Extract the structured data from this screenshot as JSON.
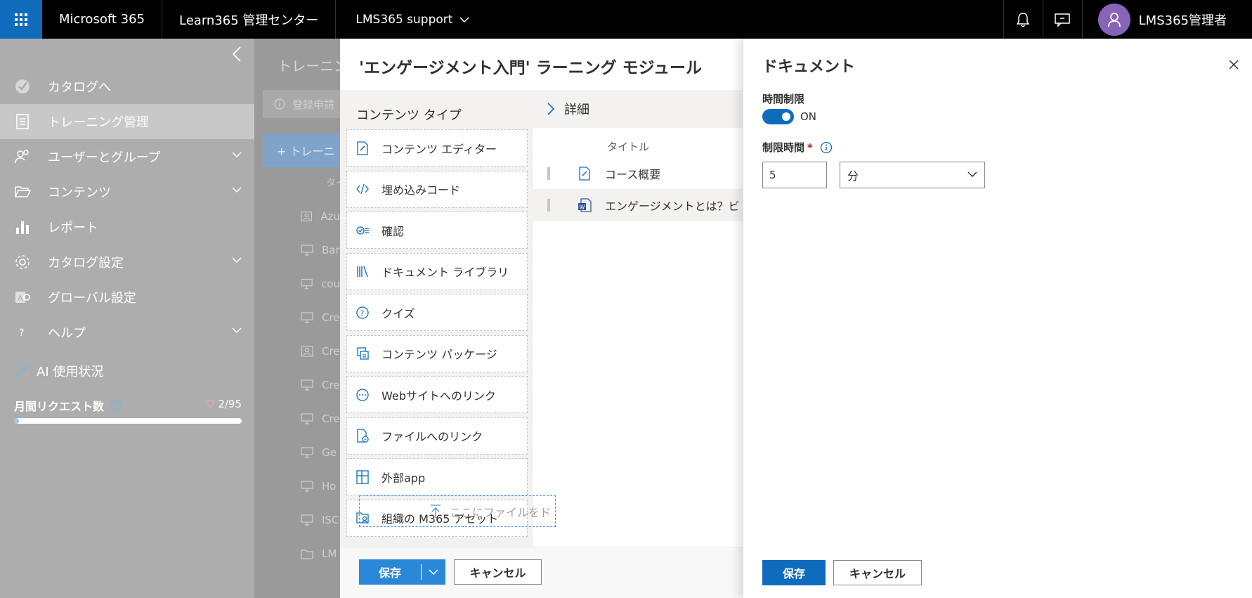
{
  "topbar": {
    "brand": "Microsoft 365",
    "app_title": "Learn365 管理センター",
    "tenant": "LMS365 support",
    "user_name": "LMS365管理者"
  },
  "sidebar": {
    "items": [
      {
        "label": "カタログへ",
        "icon": "catalog-check-icon"
      },
      {
        "label": "トレーニング管理",
        "icon": "training-doc-icon"
      },
      {
        "label": "ユーザーとグループ",
        "icon": "users-icon"
      },
      {
        "label": "コンテンツ",
        "icon": "folder-open-icon"
      },
      {
        "label": "レポート",
        "icon": "bar-chart-icon"
      },
      {
        "label": "カタログ設定",
        "icon": "gear-icon"
      },
      {
        "label": "グローバル設定",
        "icon": "global-settings-icon"
      },
      {
        "label": "ヘルプ",
        "icon": "question-icon"
      }
    ],
    "ai_usage_title": "AI 使用状況",
    "monthly_requests_label": "月間リクエスト数",
    "monthly_requests_value": "2/95",
    "monthly_requests_fraction": 0.021
  },
  "background": {
    "page_title": "トレーニング",
    "notice": "登録申請",
    "add_button": "+ トレーニ",
    "column_header": "タイ",
    "rows": [
      "Azu",
      "Bar",
      "cou",
      "Cre",
      "Cre",
      "Cre",
      "Cre",
      "Ge",
      "Ho",
      "ISC",
      "LM"
    ]
  },
  "module_panel": {
    "title": "'エンゲージメント入門' ラーニング モジュール",
    "content_types_heading": "コンテンツ タイプ",
    "content_types": [
      {
        "label": "コンテンツ エディター",
        "icon": "edit-doc-icon"
      },
      {
        "label": "埋め込みコード",
        "icon": "code-icon"
      },
      {
        "label": "確認",
        "icon": "checklist-icon"
      },
      {
        "label": "ドキュメント ライブラリ",
        "icon": "library-icon"
      },
      {
        "label": "クイズ",
        "icon": "quiz-icon"
      },
      {
        "label": "コンテンツ パッケージ",
        "icon": "package-icon"
      },
      {
        "label": "Webサイトへのリンク",
        "icon": "web-link-icon"
      },
      {
        "label": "ファイルへのリンク",
        "icon": "file-link-icon"
      },
      {
        "label": "外部app",
        "icon": "external-app-icon"
      },
      {
        "label": "組織の M365 アセット",
        "icon": "m365-asset-icon"
      }
    ],
    "details_heading": "詳細",
    "title_column": "タイトル",
    "rows": [
      {
        "title": "コース概要",
        "icon": "edit-doc-icon"
      },
      {
        "title": "エンゲージメントとは？ビ",
        "icon": "word-doc-icon"
      }
    ],
    "dropzone_text": "ここにファイルをド",
    "save_label": "保存",
    "cancel_label": "キャンセル"
  },
  "document_panel": {
    "title": "ドキュメント",
    "time_limit_label": "時間制限",
    "time_limit_state": "ON",
    "duration_label": "制限時間",
    "duration_value": "5",
    "unit_value": "分",
    "save_label": "保存",
    "cancel_label": "キャンセル"
  }
}
